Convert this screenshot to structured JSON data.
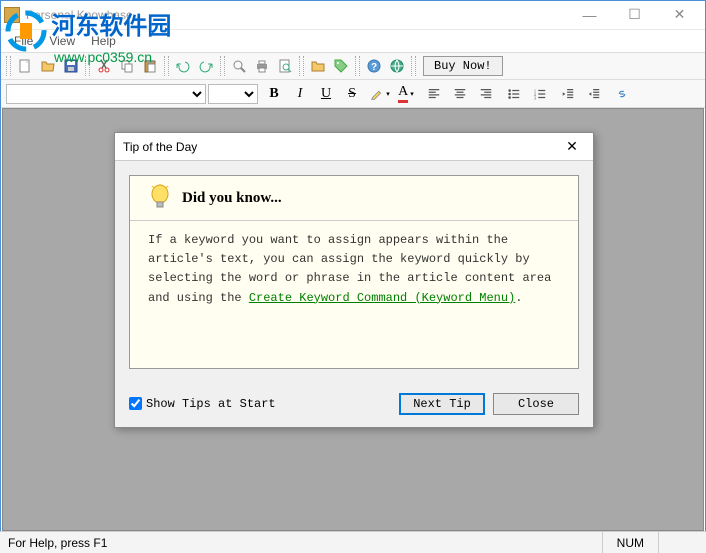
{
  "app": {
    "title": "Personal Knowbase"
  },
  "watermark": {
    "text": "河东软件园",
    "url": "www.pc0359.cn"
  },
  "menu": {
    "file": "File",
    "view": "View",
    "help": "Help"
  },
  "toolbar": {
    "buy_now": "Buy Now!"
  },
  "dialog": {
    "title": "Tip of the Day",
    "header": "Did you know...",
    "tip_part1": "If a keyword you want to assign appears within the article's text, you can assign the keyword quickly by selecting the word or phrase in the article content area and using the ",
    "tip_link": "Create Keyword Command (Keyword Menu)",
    "tip_part2": ".",
    "show_tips": "Show Tips at Start",
    "next_tip": "Next Tip",
    "close": "Close"
  },
  "status": {
    "help": "For Help, press F1",
    "num": "NUM"
  }
}
